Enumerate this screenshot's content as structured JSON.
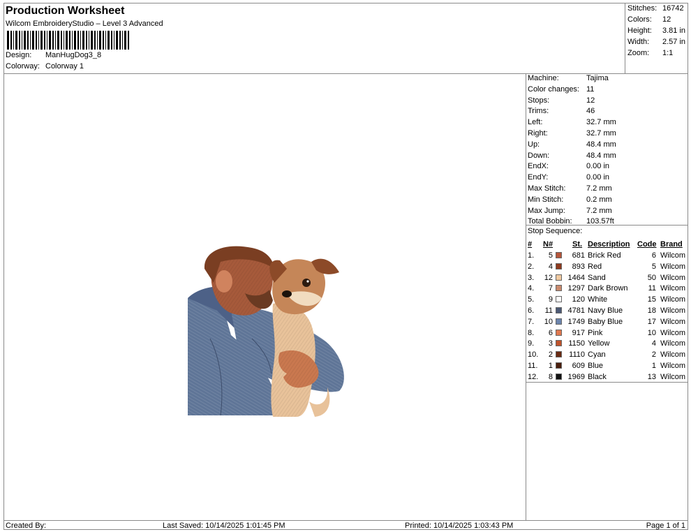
{
  "header": {
    "title": "Production Worksheet",
    "software": "Wilcom EmbroideryStudio – Level 3 Advanced",
    "design_label": "Design:",
    "design_value": "ManHugDog3_8",
    "colorway_label": "Colorway:",
    "colorway_value": "Colorway 1"
  },
  "summary": {
    "stitches_label": "Stitches:",
    "stitches": "16742",
    "colors_label": "Colors:",
    "colors": "12",
    "height_label": "Height:",
    "height": "3.81 in",
    "width_label": "Width:",
    "width": "2.57 in",
    "zoom_label": "Zoom:",
    "zoom": "1:1"
  },
  "machine_info": [
    {
      "k": "Machine:",
      "v": "Tajima"
    },
    {
      "k": "Color changes:",
      "v": "11"
    },
    {
      "k": "Stops:",
      "v": "12"
    },
    {
      "k": "Trims:",
      "v": "46"
    },
    {
      "k": "Left:",
      "v": "32.7 mm"
    },
    {
      "k": "Right:",
      "v": "32.7 mm"
    },
    {
      "k": "Up:",
      "v": "48.4 mm"
    },
    {
      "k": "Down:",
      "v": "48.4 mm"
    },
    {
      "k": "EndX:",
      "v": "0.00 in"
    },
    {
      "k": "EndY:",
      "v": "0.00 in"
    },
    {
      "k": "Max Stitch:",
      "v": "7.2 mm"
    },
    {
      "k": "Min Stitch:",
      "v": "0.2 mm"
    },
    {
      "k": "Max Jump:",
      "v": "7.2 mm"
    },
    {
      "k": "Total Bobbin:",
      "v": "103.57ft"
    }
  ],
  "stop_sequence": {
    "title": "Stop Sequence:",
    "columns": {
      "idx": "#",
      "n": "N#",
      "st": "St.",
      "desc": "Description",
      "code": "Code",
      "brand": "Brand"
    },
    "rows": [
      {
        "idx": "1.",
        "n": "5",
        "color": "#b5553a",
        "st": "681",
        "desc": "Brick Red",
        "code": "6",
        "brand": "Wilcom"
      },
      {
        "idx": "2.",
        "n": "4",
        "color": "#8e3a1d",
        "st": "893",
        "desc": "Red",
        "code": "5",
        "brand": "Wilcom"
      },
      {
        "idx": "3.",
        "n": "12",
        "color": "#f0c9a0",
        "st": "1464",
        "desc": "Sand",
        "code": "50",
        "brand": "Wilcom"
      },
      {
        "idx": "4.",
        "n": "7",
        "color": "#c98a6d",
        "st": "1297",
        "desc": "Dark Brown",
        "code": "11",
        "brand": "Wilcom"
      },
      {
        "idx": "5.",
        "n": "9",
        "color": "#ffffff",
        "st": "120",
        "desc": "White",
        "code": "15",
        "brand": "Wilcom"
      },
      {
        "idx": "6.",
        "n": "11",
        "color": "#4d5a75",
        "st": "4781",
        "desc": "Navy Blue",
        "code": "18",
        "brand": "Wilcom"
      },
      {
        "idx": "7.",
        "n": "10",
        "color": "#6b84ad",
        "st": "1749",
        "desc": "Baby Blue",
        "code": "17",
        "brand": "Wilcom"
      },
      {
        "idx": "8.",
        "n": "6",
        "color": "#e0784f",
        "st": "917",
        "desc": "Pink",
        "code": "10",
        "brand": "Wilcom"
      },
      {
        "idx": "9.",
        "n": "3",
        "color": "#c0532b",
        "st": "1150",
        "desc": "Yellow",
        "code": "4",
        "brand": "Wilcom"
      },
      {
        "idx": "10.",
        "n": "2",
        "color": "#6a2a12",
        "st": "1110",
        "desc": "Cyan",
        "code": "2",
        "brand": "Wilcom"
      },
      {
        "idx": "11.",
        "n": "1",
        "color": "#4a1e0c",
        "st": "609",
        "desc": "Blue",
        "code": "1",
        "brand": "Wilcom"
      },
      {
        "idx": "12.",
        "n": "8",
        "color": "#111111",
        "st": "1969",
        "desc": "Black",
        "code": "13",
        "brand": "Wilcom"
      }
    ]
  },
  "footer": {
    "created_by": "Created By:",
    "last_saved": "Last Saved: 10/14/2025 1:01:45 PM",
    "printed": "Printed: 10/14/2025 1:03:43 PM",
    "page": "Page 1 of 1"
  }
}
